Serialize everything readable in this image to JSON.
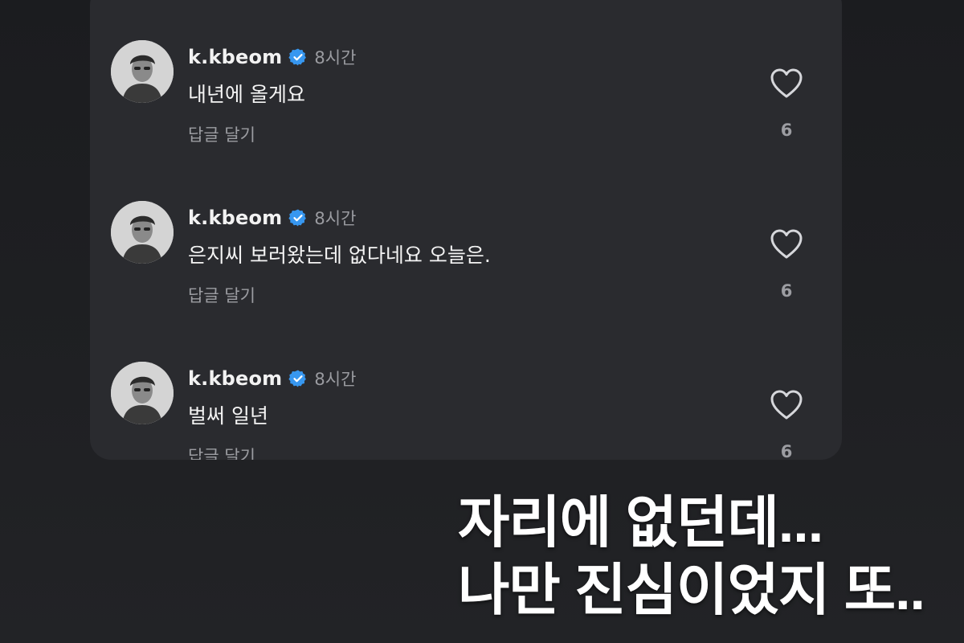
{
  "comments": [
    {
      "username": "k.kbeom",
      "time": "8시간",
      "text": "내년에 올게요",
      "reply_label": "답글 달기",
      "likes": "6",
      "verified_icon": "verified-badge-icon",
      "like_icon": "heart-outline-icon"
    },
    {
      "username": "k.kbeom",
      "time": "8시간",
      "text": "은지씨 보러왔는데 없다네요 오늘은.",
      "reply_label": "답글 달기",
      "likes": "6",
      "verified_icon": "verified-badge-icon",
      "like_icon": "heart-outline-icon"
    },
    {
      "username": "k.kbeom",
      "time": "8시간",
      "text": "벌써 일년",
      "reply_label": "답글 달기",
      "likes": "6",
      "verified_icon": "verified-badge-icon",
      "like_icon": "heart-outline-icon"
    }
  ],
  "caption": {
    "line1": "자리에 없던데...",
    "line2": "나만 진심이었지 또.."
  },
  "colors": {
    "background": "#1d1e21",
    "panel": "#2a2b2f",
    "verified_blue": "#3797f0",
    "secondary_text": "#9c9da2"
  }
}
